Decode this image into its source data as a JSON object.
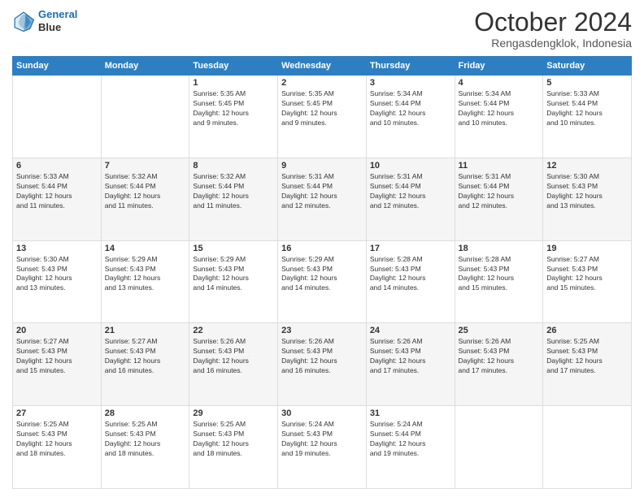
{
  "header": {
    "logo_line1": "General",
    "logo_line2": "Blue",
    "month": "October 2024",
    "location": "Rengasdengklok, Indonesia"
  },
  "weekdays": [
    "Sunday",
    "Monday",
    "Tuesday",
    "Wednesday",
    "Thursday",
    "Friday",
    "Saturday"
  ],
  "weeks": [
    [
      {
        "day": null,
        "info": null
      },
      {
        "day": null,
        "info": null
      },
      {
        "day": "1",
        "info": "Sunrise: 5:35 AM\nSunset: 5:45 PM\nDaylight: 12 hours\nand 9 minutes."
      },
      {
        "day": "2",
        "info": "Sunrise: 5:35 AM\nSunset: 5:45 PM\nDaylight: 12 hours\nand 9 minutes."
      },
      {
        "day": "3",
        "info": "Sunrise: 5:34 AM\nSunset: 5:44 PM\nDaylight: 12 hours\nand 10 minutes."
      },
      {
        "day": "4",
        "info": "Sunrise: 5:34 AM\nSunset: 5:44 PM\nDaylight: 12 hours\nand 10 minutes."
      },
      {
        "day": "5",
        "info": "Sunrise: 5:33 AM\nSunset: 5:44 PM\nDaylight: 12 hours\nand 10 minutes."
      }
    ],
    [
      {
        "day": "6",
        "info": "Sunrise: 5:33 AM\nSunset: 5:44 PM\nDaylight: 12 hours\nand 11 minutes."
      },
      {
        "day": "7",
        "info": "Sunrise: 5:32 AM\nSunset: 5:44 PM\nDaylight: 12 hours\nand 11 minutes."
      },
      {
        "day": "8",
        "info": "Sunrise: 5:32 AM\nSunset: 5:44 PM\nDaylight: 12 hours\nand 11 minutes."
      },
      {
        "day": "9",
        "info": "Sunrise: 5:31 AM\nSunset: 5:44 PM\nDaylight: 12 hours\nand 12 minutes."
      },
      {
        "day": "10",
        "info": "Sunrise: 5:31 AM\nSunset: 5:44 PM\nDaylight: 12 hours\nand 12 minutes."
      },
      {
        "day": "11",
        "info": "Sunrise: 5:31 AM\nSunset: 5:44 PM\nDaylight: 12 hours\nand 12 minutes."
      },
      {
        "day": "12",
        "info": "Sunrise: 5:30 AM\nSunset: 5:43 PM\nDaylight: 12 hours\nand 13 minutes."
      }
    ],
    [
      {
        "day": "13",
        "info": "Sunrise: 5:30 AM\nSunset: 5:43 PM\nDaylight: 12 hours\nand 13 minutes."
      },
      {
        "day": "14",
        "info": "Sunrise: 5:29 AM\nSunset: 5:43 PM\nDaylight: 12 hours\nand 13 minutes."
      },
      {
        "day": "15",
        "info": "Sunrise: 5:29 AM\nSunset: 5:43 PM\nDaylight: 12 hours\nand 14 minutes."
      },
      {
        "day": "16",
        "info": "Sunrise: 5:29 AM\nSunset: 5:43 PM\nDaylight: 12 hours\nand 14 minutes."
      },
      {
        "day": "17",
        "info": "Sunrise: 5:28 AM\nSunset: 5:43 PM\nDaylight: 12 hours\nand 14 minutes."
      },
      {
        "day": "18",
        "info": "Sunrise: 5:28 AM\nSunset: 5:43 PM\nDaylight: 12 hours\nand 15 minutes."
      },
      {
        "day": "19",
        "info": "Sunrise: 5:27 AM\nSunset: 5:43 PM\nDaylight: 12 hours\nand 15 minutes."
      }
    ],
    [
      {
        "day": "20",
        "info": "Sunrise: 5:27 AM\nSunset: 5:43 PM\nDaylight: 12 hours\nand 15 minutes."
      },
      {
        "day": "21",
        "info": "Sunrise: 5:27 AM\nSunset: 5:43 PM\nDaylight: 12 hours\nand 16 minutes."
      },
      {
        "day": "22",
        "info": "Sunrise: 5:26 AM\nSunset: 5:43 PM\nDaylight: 12 hours\nand 16 minutes."
      },
      {
        "day": "23",
        "info": "Sunrise: 5:26 AM\nSunset: 5:43 PM\nDaylight: 12 hours\nand 16 minutes."
      },
      {
        "day": "24",
        "info": "Sunrise: 5:26 AM\nSunset: 5:43 PM\nDaylight: 12 hours\nand 17 minutes."
      },
      {
        "day": "25",
        "info": "Sunrise: 5:26 AM\nSunset: 5:43 PM\nDaylight: 12 hours\nand 17 minutes."
      },
      {
        "day": "26",
        "info": "Sunrise: 5:25 AM\nSunset: 5:43 PM\nDaylight: 12 hours\nand 17 minutes."
      }
    ],
    [
      {
        "day": "27",
        "info": "Sunrise: 5:25 AM\nSunset: 5:43 PM\nDaylight: 12 hours\nand 18 minutes."
      },
      {
        "day": "28",
        "info": "Sunrise: 5:25 AM\nSunset: 5:43 PM\nDaylight: 12 hours\nand 18 minutes."
      },
      {
        "day": "29",
        "info": "Sunrise: 5:25 AM\nSunset: 5:43 PM\nDaylight: 12 hours\nand 18 minutes."
      },
      {
        "day": "30",
        "info": "Sunrise: 5:24 AM\nSunset: 5:43 PM\nDaylight: 12 hours\nand 19 minutes."
      },
      {
        "day": "31",
        "info": "Sunrise: 5:24 AM\nSunset: 5:44 PM\nDaylight: 12 hours\nand 19 minutes."
      },
      {
        "day": null,
        "info": null
      },
      {
        "day": null,
        "info": null
      }
    ]
  ]
}
